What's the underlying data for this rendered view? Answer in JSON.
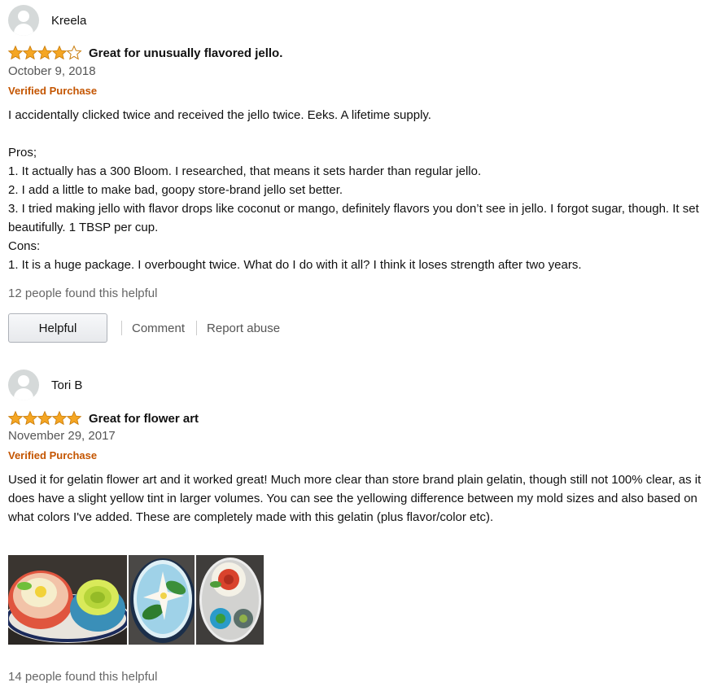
{
  "reviews": [
    {
      "profile_name": "Kreela",
      "stars": 4,
      "title": "Great for unusually flavored jello.",
      "date": "October 9, 2018",
      "verified": "Verified Purchase",
      "body": [
        "I accidentally clicked twice and received the jello twice. Eeks. A lifetime supply.",
        "",
        "Pros;",
        "1. It actually has a 300 Bloom. I researched, that means it sets harder than regular jello.",
        "2. I add a little to make bad, goopy store-brand jello set better.",
        "3. I tried making jello with flavor drops like coconut or mango, definitely flavors you don’t see in jello. I forgot sugar, though. It set beautifully. 1 TBSP per cup.",
        "Cons:",
        "1. It is a huge package. I overbought twice. What do I do with it all? I think it loses strength after two years."
      ],
      "helpful_count": "12 people found this helpful",
      "helpful_button": "Helpful",
      "comment_link": "Comment",
      "report_link": "Report abuse"
    },
    {
      "profile_name": "Tori B",
      "stars": 5,
      "title": "Great for flower art",
      "date": "November 29, 2017",
      "verified": "Verified Purchase",
      "body": [
        "Used it for gelatin flower art and it worked great! Much more clear than store brand plain gelatin, though still not 100% clear, as it does have a slight yellow tint in larger volumes. You can see the yellowing difference between my mold sizes and also based on what colors I've added. These are completely made with this gelatin (plus flavor/color etc)."
      ],
      "images": [
        "gelatin-flower-photo-1",
        "gelatin-flower-photo-2",
        "gelatin-flower-photo-3"
      ],
      "helpful_count": "14 people found this helpful"
    }
  ],
  "colors": {
    "star_fill": "#f5a623",
    "star_stroke": "#c97c0a",
    "verified": "#c45500",
    "muted_text": "#555555"
  }
}
